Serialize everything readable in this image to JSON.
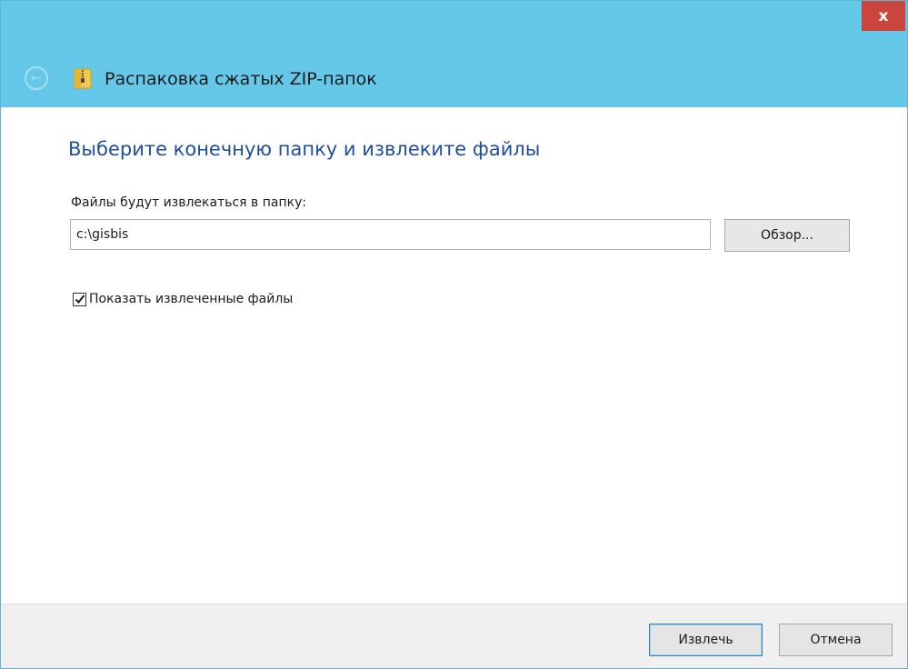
{
  "window": {
    "title": "Распаковка сжатых ZIP-папок",
    "close_label": "x"
  },
  "content": {
    "heading": "Выберите конечную папку и извлеките файлы",
    "path_label": "Файлы будут извлекаться в папку:",
    "path_value": "c:\\gisbis",
    "browse_label": "Обзор...",
    "show_files_label": "Показать извлеченные файлы",
    "show_files_checked": true
  },
  "footer": {
    "extract_label": "Извлечь",
    "cancel_label": "Отмена"
  },
  "colors": {
    "titlebar": "#65c8e8",
    "close": "#c9453d",
    "heading": "#1f4e9c"
  },
  "icons": {
    "back": "back-arrow-icon",
    "zip": "zip-folder-icon",
    "checkmark": "checkmark-icon"
  }
}
